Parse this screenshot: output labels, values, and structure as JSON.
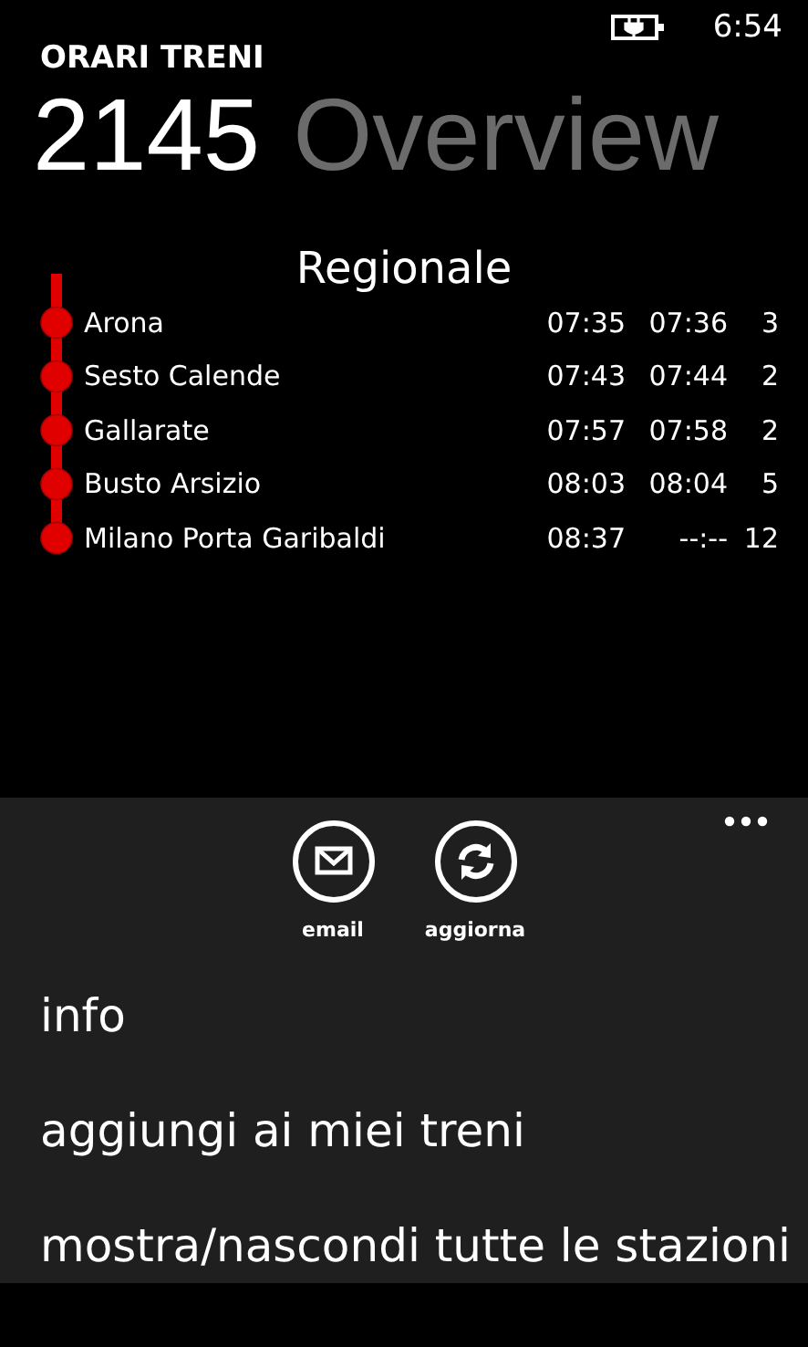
{
  "status_bar": {
    "time": "6:54"
  },
  "app_title": "ORARI TRENI",
  "page": {
    "number": "2145",
    "title": "Overview"
  },
  "train_type": "Regionale",
  "stops": [
    {
      "station": "Arona",
      "arrival": "07:35",
      "departure": "07:36",
      "platform": "3"
    },
    {
      "station": "Sesto Calende",
      "arrival": "07:43",
      "departure": "07:44",
      "platform": "2"
    },
    {
      "station": "Gallarate",
      "arrival": "07:57",
      "departure": "07:58",
      "platform": "2"
    },
    {
      "station": "Busto Arsizio",
      "arrival": "08:03",
      "departure": "08:04",
      "platform": "5"
    },
    {
      "station": "Milano Porta Garibaldi",
      "arrival": "08:37",
      "departure": "--:--",
      "platform": "12"
    }
  ],
  "app_bar": {
    "buttons": [
      {
        "kind": "email",
        "label": "email"
      },
      {
        "kind": "refresh",
        "label": "aggiorna"
      }
    ],
    "menu_items": [
      "info",
      "aggiungi ai miei treni",
      "mostra/nascondi tutte le stazioni"
    ]
  }
}
